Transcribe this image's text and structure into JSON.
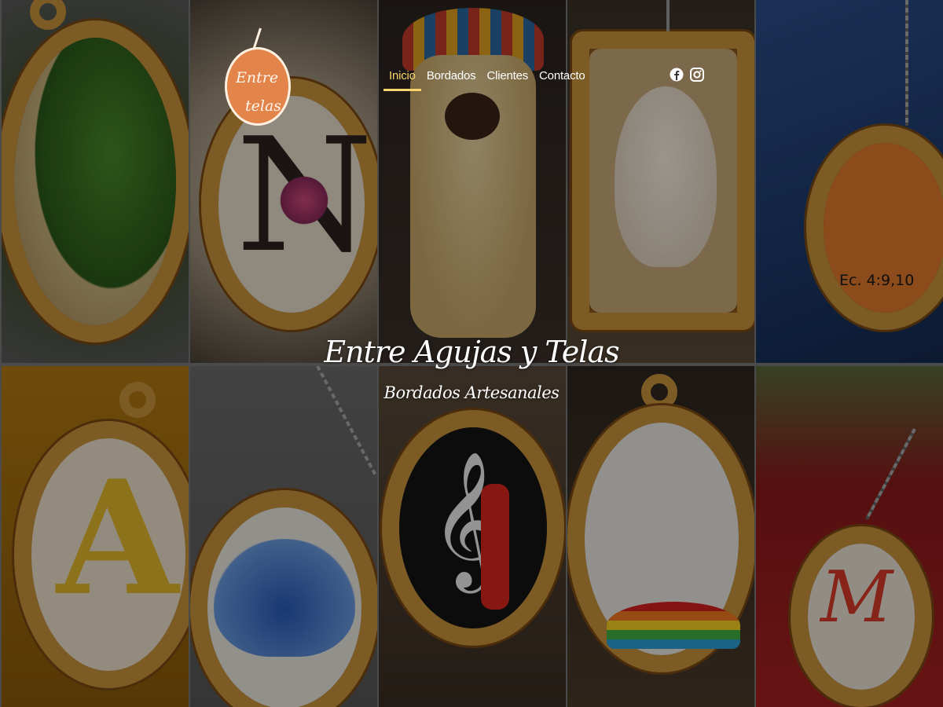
{
  "brand": {
    "logo_line1": "Entre",
    "logo_line2": "telas",
    "title": "Entre Agujas y Telas",
    "subtitle": "Bordados Artesanales"
  },
  "nav": {
    "items": [
      {
        "label": "Inicio",
        "active": true
      },
      {
        "label": "Bordados",
        "active": false
      },
      {
        "label": "Clientes",
        "active": false
      },
      {
        "label": "Contacto",
        "active": false
      }
    ]
  },
  "social": {
    "icons": [
      "facebook-icon",
      "instagram-icon"
    ]
  },
  "gallery": {
    "tiles": [
      {
        "name": "embroidery-landscape-pendant"
      },
      {
        "name": "embroidery-letter-n-pendant"
      },
      {
        "name": "embroidery-llama-pendant"
      },
      {
        "name": "embroidery-puppy-pendant"
      },
      {
        "name": "embroidery-hands-pendant",
        "text": "Ec. 4:9,10"
      },
      {
        "name": "embroidery-letter-a-pendant"
      },
      {
        "name": "embroidery-blue-flower-pendant"
      },
      {
        "name": "embroidery-music-pendant"
      },
      {
        "name": "embroidery-family-pendant"
      },
      {
        "name": "embroidery-letter-m-pendant"
      }
    ]
  },
  "colors": {
    "accent": "#f7d56a",
    "logo": "#e3844a",
    "wood": "#c9933c"
  }
}
